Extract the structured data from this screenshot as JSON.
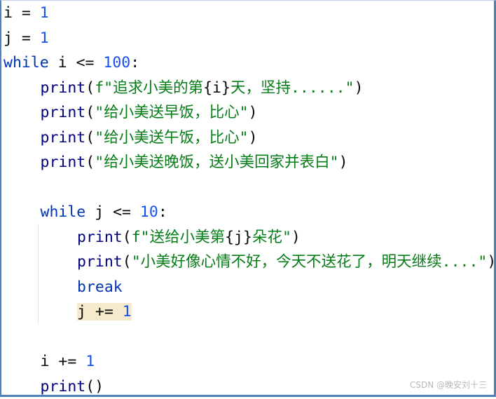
{
  "editor": {
    "lines": [
      {
        "indent": 0,
        "tokens": [
          {
            "t": "var",
            "v": "i"
          },
          {
            "t": "op",
            "v": " = "
          },
          {
            "t": "num",
            "v": "1"
          }
        ]
      },
      {
        "indent": 0,
        "tokens": [
          {
            "t": "var",
            "v": "j"
          },
          {
            "t": "op",
            "v": " = "
          },
          {
            "t": "num",
            "v": "1"
          }
        ]
      },
      {
        "indent": 0,
        "tokens": [
          {
            "t": "kw",
            "v": "while"
          },
          {
            "t": "op",
            "v": " "
          },
          {
            "t": "var",
            "v": "i"
          },
          {
            "t": "op",
            "v": " <= "
          },
          {
            "t": "num",
            "v": "100"
          },
          {
            "t": "op",
            "v": ":"
          }
        ]
      },
      {
        "indent": 1,
        "tokens": [
          {
            "t": "fn",
            "v": "print"
          },
          {
            "t": "op",
            "v": "("
          },
          {
            "t": "str",
            "v": "f\"追求小美的第"
          },
          {
            "t": "var",
            "v": "{i}"
          },
          {
            "t": "str",
            "v": "天，坚持......\""
          },
          {
            "t": "op",
            "v": ")"
          }
        ]
      },
      {
        "indent": 1,
        "tokens": [
          {
            "t": "fn",
            "v": "print"
          },
          {
            "t": "op",
            "v": "("
          },
          {
            "t": "str",
            "v": "\"给小美送早饭，比心\""
          },
          {
            "t": "op",
            "v": ")"
          }
        ]
      },
      {
        "indent": 1,
        "tokens": [
          {
            "t": "fn",
            "v": "print"
          },
          {
            "t": "op",
            "v": "("
          },
          {
            "t": "str",
            "v": "\"给小美送午饭，比心\""
          },
          {
            "t": "op",
            "v": ")"
          }
        ]
      },
      {
        "indent": 1,
        "tokens": [
          {
            "t": "fn",
            "v": "print"
          },
          {
            "t": "op",
            "v": "("
          },
          {
            "t": "str",
            "v": "\"给小美送晚饭，送小美回家并表白\""
          },
          {
            "t": "op",
            "v": ")"
          }
        ]
      },
      {
        "indent": 0,
        "tokens": []
      },
      {
        "indent": 1,
        "tokens": [
          {
            "t": "kw",
            "v": "while"
          },
          {
            "t": "op",
            "v": " "
          },
          {
            "t": "var",
            "v": "j"
          },
          {
            "t": "op",
            "v": " <= "
          },
          {
            "t": "num",
            "v": "10"
          },
          {
            "t": "op",
            "v": ":"
          }
        ]
      },
      {
        "indent": 2,
        "tokens": [
          {
            "t": "fn",
            "v": "print"
          },
          {
            "t": "op",
            "v": "("
          },
          {
            "t": "str",
            "v": "f\"送给小美第"
          },
          {
            "t": "var",
            "v": "{j}"
          },
          {
            "t": "str",
            "v": "朵花\""
          },
          {
            "t": "op",
            "v": ")"
          }
        ]
      },
      {
        "indent": 2,
        "tokens": [
          {
            "t": "fn",
            "v": "print"
          },
          {
            "t": "op",
            "v": "("
          },
          {
            "t": "str",
            "v": "\"小美好像心情不好，今天不送花了，明天继续....\""
          },
          {
            "t": "op",
            "v": ")"
          }
        ]
      },
      {
        "indent": 2,
        "tokens": [
          {
            "t": "kw",
            "v": "break"
          }
        ]
      },
      {
        "indent": 2,
        "highlight": true,
        "tokens": [
          {
            "t": "var",
            "v": "j"
          },
          {
            "t": "op",
            "v": " += "
          },
          {
            "t": "num",
            "v": "1"
          }
        ]
      },
      {
        "indent": 0,
        "tokens": []
      },
      {
        "indent": 1,
        "tokens": [
          {
            "t": "var",
            "v": "i"
          },
          {
            "t": "op",
            "v": " += "
          },
          {
            "t": "num",
            "v": "1"
          }
        ]
      },
      {
        "indent": 1,
        "tokens": [
          {
            "t": "fn",
            "v": "print"
          },
          {
            "t": "op",
            "v": "()"
          }
        ]
      }
    ]
  },
  "watermark": "CSDN @晚安刘十三"
}
